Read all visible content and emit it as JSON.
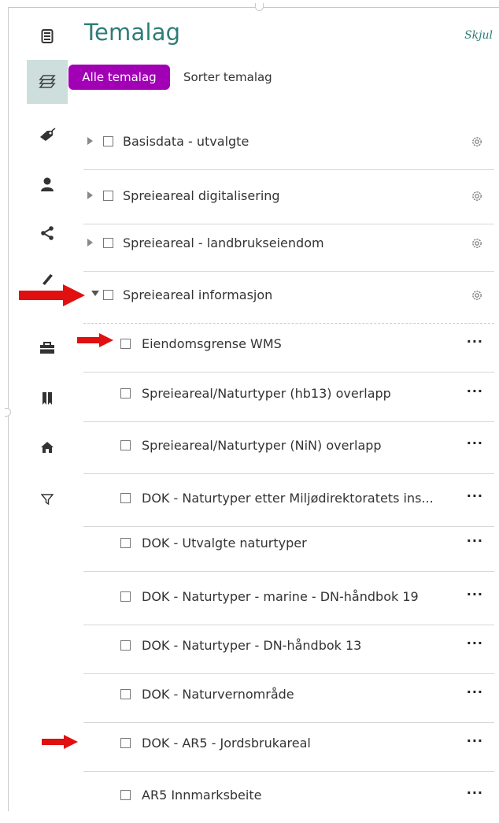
{
  "panel": {
    "title": "Temalag",
    "hide_label": "Skjul",
    "tabs": [
      {
        "label": "Alle temalag",
        "active": true
      },
      {
        "label": "Sorter temalag",
        "active": false
      }
    ]
  },
  "sidebar": {
    "items": [
      {
        "icon": "document-icon"
      },
      {
        "icon": "layers-icon",
        "active": true
      },
      {
        "icon": "tag-icon"
      },
      {
        "icon": "person-icon"
      },
      {
        "icon": "share-icon"
      },
      {
        "icon": "pencil-icon"
      },
      {
        "icon": "toolbox-icon"
      },
      {
        "icon": "bookmark-icon"
      },
      {
        "icon": "home-icon"
      },
      {
        "icon": "filter-icon"
      }
    ]
  },
  "layers": {
    "groups": [
      {
        "label": "Basisdata - utvalgte",
        "expanded": false
      },
      {
        "label": "Spreieareal digitalisering",
        "expanded": false
      },
      {
        "label": "Spreieareal - landbrukseiendom",
        "expanded": false
      },
      {
        "label": "Spreieareal informasjon",
        "expanded": true
      }
    ],
    "items": [
      {
        "label": "Eiendomsgrense WMS"
      },
      {
        "label": "Spreieareal/Naturtyper (hb13) overlapp"
      },
      {
        "label": "Spreieareal/Naturtyper (NiN) overlapp"
      },
      {
        "label": "DOK - Naturtyper etter Miljødirektoratets ins..."
      },
      {
        "label": "DOK - Utvalgte naturtyper"
      },
      {
        "label": "DOK - Naturtyper - marine - DN-håndbok 19"
      },
      {
        "label": "DOK - Naturtyper - DN-håndbok 13"
      },
      {
        "label": "DOK - Naturvernområde"
      },
      {
        "label": "DOK - AR5 - Jordsbrukareal"
      },
      {
        "label": "AR5 Innmarksbeite"
      }
    ],
    "more_label": "···"
  },
  "colors": {
    "accent": "#2f7d78",
    "tab_active": "#a100b4",
    "sidebar_active": "#cddedd",
    "annotation_arrow": "#e01010"
  }
}
